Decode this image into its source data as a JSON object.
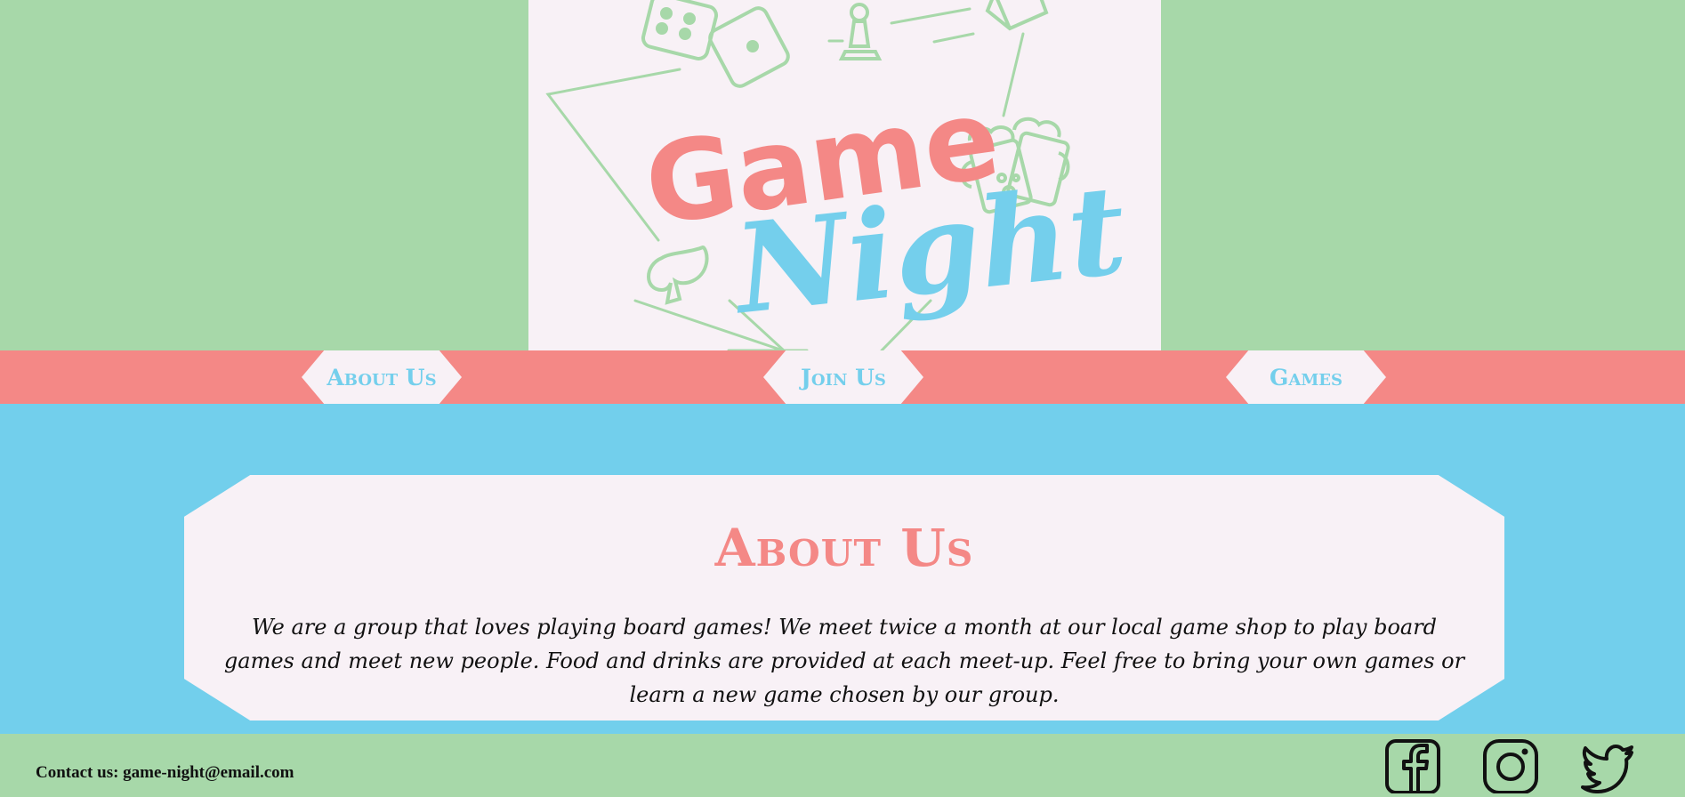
{
  "logo": {
    "line1": "Game",
    "line2": "Night"
  },
  "nav": {
    "items": [
      {
        "label": "About Us"
      },
      {
        "label": "Join Us"
      },
      {
        "label": "Games"
      }
    ]
  },
  "about": {
    "title": "About Us",
    "body": "We are a group that loves playing board games! We meet twice a month at our local game shop to play board games and meet new people. Food and drinks are provided at each meet-up. Feel free to bring your own games or learn a new game chosen by our group."
  },
  "footer": {
    "contact": "Contact us: game-night@email.com",
    "social": [
      {
        "icon": "facebook-icon"
      },
      {
        "icon": "instagram-icon"
      },
      {
        "icon": "twitter-icon"
      }
    ]
  },
  "colors": {
    "green": "#a7d8a9",
    "coral": "#f48886",
    "sky": "#72cfec",
    "card": "#f8f1f6"
  }
}
